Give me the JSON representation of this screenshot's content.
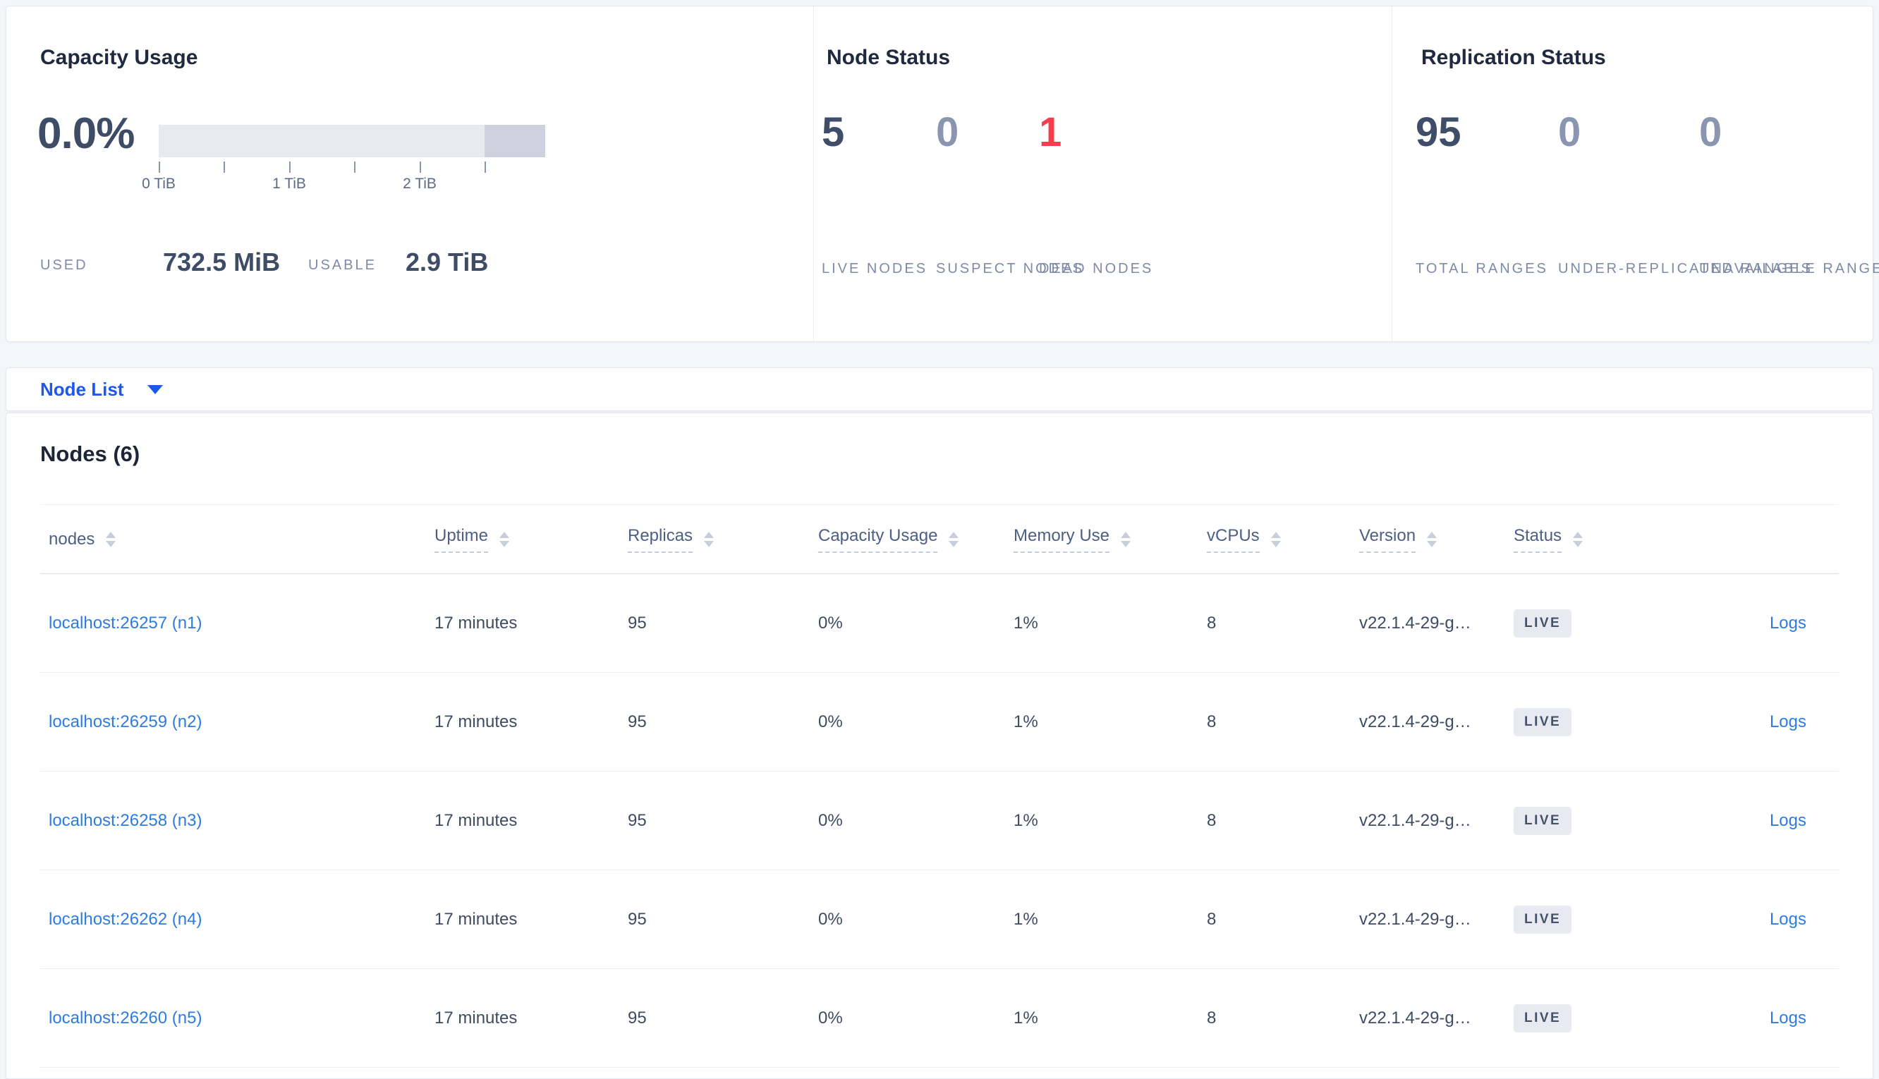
{
  "colors": {
    "bg": "#f4f6fa",
    "accent": "#1b57f0",
    "link": "#2d7ce0",
    "danger": "#fb3b4e",
    "num-primary": "#3f4d68",
    "num-muted": "#8a96b0",
    "badge-bg": "#e7eaf0",
    "bar-light": "#e8eaf1",
    "bar-dark": "#cdd2de"
  },
  "summary": {
    "capacity": {
      "title": "Capacity Usage",
      "percent_used": "0.0%",
      "tick_labels": [
        "0 TiB",
        "1 TiB",
        "2 TiB"
      ],
      "used_label": "USED",
      "used_value": "732.5 MiB",
      "usable_label": "USABLE",
      "usable_value": "2.9 TiB"
    },
    "node_status": {
      "title": "Node Status",
      "stats": [
        {
          "value": "5",
          "label": "LIVE NODES",
          "tone": "primary"
        },
        {
          "value": "0",
          "label": "SUSPECT NODES",
          "tone": "muted"
        },
        {
          "value": "1",
          "label": "DEAD NODES",
          "tone": "danger"
        }
      ]
    },
    "replication": {
      "title": "Replication Status",
      "stats": [
        {
          "value": "95",
          "label": "TOTAL RANGES",
          "tone": "primary"
        },
        {
          "value": "0",
          "label": "UNDER-REPLICATED RANGES",
          "tone": "muted"
        },
        {
          "value": "0",
          "label": "UNAVAILABLE RANGES",
          "tone": "muted"
        }
      ]
    }
  },
  "view_selector": {
    "selected": "Node List",
    "caret_icon": "chevron-down"
  },
  "nodes_panel": {
    "title": "Nodes (6)",
    "columns": [
      {
        "label": "nodes"
      },
      {
        "label": "Uptime"
      },
      {
        "label": "Replicas"
      },
      {
        "label": "Capacity Usage"
      },
      {
        "label": "Memory Use"
      },
      {
        "label": "vCPUs"
      },
      {
        "label": "Version"
      },
      {
        "label": "Status"
      }
    ],
    "rows": [
      {
        "name": "localhost:26257 (n1)",
        "uptime": "17 minutes",
        "replicas": "95",
        "capacity": "0%",
        "memory": "1%",
        "vcpus": "8",
        "version": "v22.1.4-29-g…",
        "status": "LIVE",
        "logs": "Logs"
      },
      {
        "name": "localhost:26259 (n2)",
        "uptime": "17 minutes",
        "replicas": "95",
        "capacity": "0%",
        "memory": "1%",
        "vcpus": "8",
        "version": "v22.1.4-29-g…",
        "status": "LIVE",
        "logs": "Logs"
      },
      {
        "name": "localhost:26258 (n3)",
        "uptime": "17 minutes",
        "replicas": "95",
        "capacity": "0%",
        "memory": "1%",
        "vcpus": "8",
        "version": "v22.1.4-29-g…",
        "status": "LIVE",
        "logs": "Logs"
      },
      {
        "name": "localhost:26262 (n4)",
        "uptime": "17 minutes",
        "replicas": "95",
        "capacity": "0%",
        "memory": "1%",
        "vcpus": "8",
        "version": "v22.1.4-29-g…",
        "status": "LIVE",
        "logs": "Logs"
      },
      {
        "name": "localhost:26260 (n5)",
        "uptime": "17 minutes",
        "replicas": "95",
        "capacity": "0%",
        "memory": "1%",
        "vcpus": "8",
        "version": "v22.1.4-29-g…",
        "status": "LIVE",
        "logs": "Logs"
      }
    ]
  }
}
